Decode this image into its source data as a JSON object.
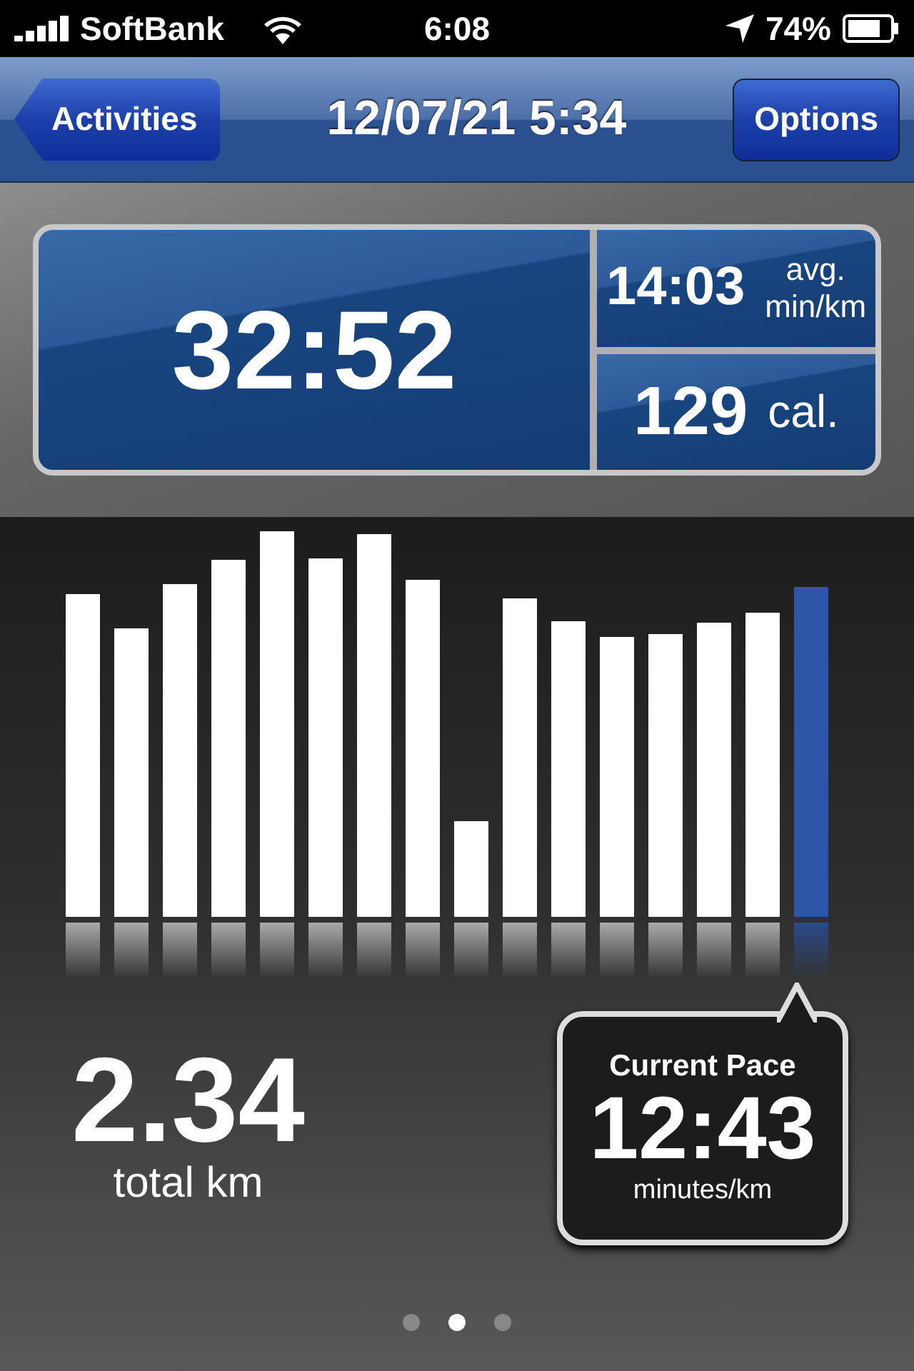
{
  "status_bar": {
    "carrier": "SoftBank",
    "time": "6:08",
    "battery": "74%"
  },
  "nav_bar": {
    "back_button": "Activities",
    "title": "12/07/21 5:34",
    "right_button": "Options"
  },
  "summary": {
    "duration": "32:52",
    "pace": "14:03",
    "pace_unit_top": "avg.",
    "pace_unit_bottom": "min/km",
    "calories": "129",
    "calories_unit": "cal."
  },
  "splits": [
    {
      "selected": false
    },
    {
      "selected": false
    },
    {
      "selected": false
    },
    {
      "selected": false
    },
    {
      "selected": false
    },
    {
      "selected": false
    },
    {
      "selected": false
    },
    {
      "selected": false
    },
    {
      "selected": false
    },
    {
      "selected": false
    },
    {
      "selected": false
    },
    {
      "selected": false
    },
    {
      "selected": false
    },
    {
      "selected": false
    },
    {
      "selected": false
    },
    {
      "selected": true
    }
  ],
  "distance": {
    "value": "2.34",
    "unit": "total km"
  },
  "current_pace": {
    "label": "Current Pace",
    "value": "12:43",
    "unit": "minutes/km"
  },
  "page_dots": [
    {
      "selected": false
    },
    {
      "selected": true
    },
    {
      "selected": false
    }
  ]
}
